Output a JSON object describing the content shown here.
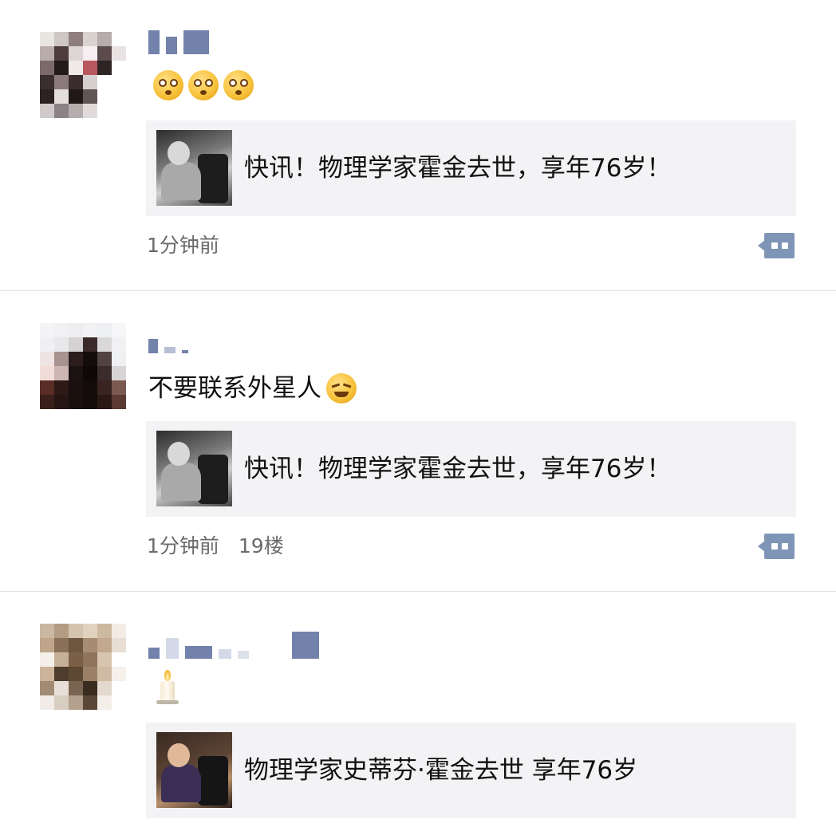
{
  "posts": [
    {
      "text": "",
      "emojis": [
        "shocked-face-emoji",
        "shocked-face-emoji",
        "shocked-face-emoji"
      ],
      "link_title": "快讯！物理学家霍金去世，享年76岁！",
      "time": "1分钟前",
      "floor": ""
    },
    {
      "text": "不要联系外星人",
      "emojis": [
        "squint-cry-face-emoji"
      ],
      "link_title": "快讯！物理学家霍金去世，享年76岁！",
      "time": "1分钟前",
      "floor": "19楼"
    },
    {
      "text": "",
      "emojis": [
        "candle-emoji"
      ],
      "link_title": "物理学家史蒂芬·霍金去世 享年76岁",
      "time": "",
      "floor": ""
    }
  ],
  "colors": {
    "link_bg": "#f3f3f5",
    "meta_text": "#6b6b6b",
    "comment_button": "#7e95b6",
    "divider": "#e2e2e2"
  }
}
